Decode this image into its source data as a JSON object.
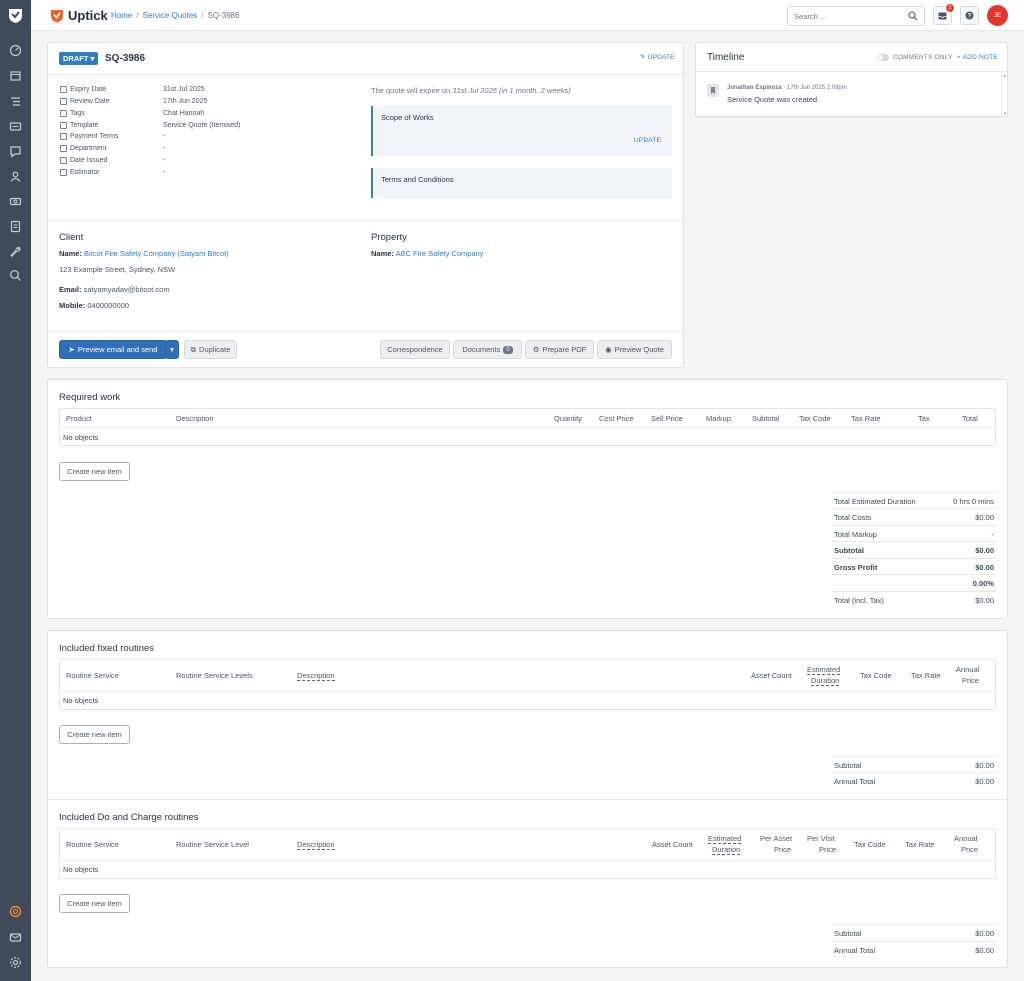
{
  "app": {
    "brand": "Uptick",
    "accent": "#2f7dc2",
    "brand_color": "#f26522"
  },
  "sidebar": {
    "icons": [
      "dashboard-icon",
      "calendar-icon",
      "tasks-icon",
      "card-icon",
      "chat-icon",
      "user-icon",
      "money-icon",
      "document-icon",
      "wrench-icon",
      "search-globe-icon"
    ],
    "bottom_icons": [
      "support-icon",
      "mail-icon",
      "settings-icon"
    ]
  },
  "header": {
    "breadcrumb": [
      "Home",
      "Service Quotes",
      "SQ-3986"
    ],
    "search_placeholder": "Search ...",
    "notification_count": "1",
    "avatar_initials": "JE"
  },
  "quote": {
    "status": "DRAFT",
    "id": "SQ-3986",
    "update_label": "UPDATE",
    "details": [
      {
        "label": "Expiry Date",
        "value": "31st Jul 2025",
        "link": false
      },
      {
        "label": "Review Date",
        "value": "17th Jun 2025",
        "link": false
      },
      {
        "label": "Tags",
        "value": "Chat Hannah",
        "link": true
      },
      {
        "label": "Template",
        "value": "Service Quote (Itemised)",
        "link": false
      },
      {
        "label": "Payment Terms",
        "value": "-",
        "link": false
      },
      {
        "label": "Department",
        "value": "-",
        "link": false
      },
      {
        "label": "Date Issued",
        "value": "-",
        "link": false
      },
      {
        "label": "Estimator",
        "value": "-",
        "link": false
      }
    ],
    "expire_prefix": "The quote will expire on ",
    "expire_value": "31st Jul 2025 (in 1 month, 2 weeks)",
    "scope_title": "Scope of Works",
    "scope_update": "UPDATE",
    "terms_title": "Terms and Conditions",
    "client": {
      "title": "Client",
      "name_label": "Name:",
      "name": "Bitcot Fire Safety Company (Satyam Bitcot)",
      "address": "123 Example Street, Sydney, NSW",
      "email_label": "Email:",
      "email": "satyamyadav@bitcot.com",
      "mobile_label": "Mobile:",
      "mobile": "0400000000"
    },
    "property": {
      "title": "Property",
      "name_label": "Name:",
      "name": "ABC Fire Safety Company"
    },
    "actions": {
      "preview_send": "Preview email and send",
      "duplicate": "Duplicate",
      "correspondence": "Correspondence",
      "documents": "Documents",
      "documents_count": "0",
      "prepare_pdf": "Prepare PDF",
      "preview_quote": "Preview Quote"
    }
  },
  "timeline": {
    "title": "Timeline",
    "comments_only": "COMMENTS ONLY",
    "add_note": "+ ADD NOTE",
    "entries": [
      {
        "author": "Jonathan Espinoza",
        "time": "17th Jun 2025 2:09pm",
        "text": "Service Quote was created."
      }
    ]
  },
  "required_work": {
    "title": "Required work",
    "columns": [
      "Product",
      "Description",
      "Quantity",
      "Cost Price",
      "Sell Price",
      "Markup",
      "Subtotal",
      "Tax Code",
      "Tax Rate",
      "Tax",
      "Total"
    ],
    "empty": "No objects",
    "create_label": "Create new item",
    "summary": [
      {
        "label": "Total Estimated Duration",
        "value": "0 hrs 0 mins",
        "bold": false
      },
      {
        "label": "Total Costs",
        "value": "$0.00",
        "bold": false
      },
      {
        "label": "Total Markup",
        "value": "-",
        "bold": false
      },
      {
        "label": "Subtotal",
        "value": "$0.00",
        "bold": true
      },
      {
        "label": "Gross Profit",
        "value": "$0.00",
        "bold": true
      },
      {
        "label": "",
        "value": "0.00%",
        "bold": true
      },
      {
        "label": "Total (incl. Tax)",
        "value": "$0.00",
        "bold": false
      }
    ]
  },
  "fixed_routines": {
    "title": "Included fixed routines",
    "columns": [
      "Routine Service",
      "Routine Service Levels",
      "Description",
      "Asset Count",
      "Estimated",
      "Duration",
      "Tax Code",
      "Tax Rate",
      "Annual",
      "Price"
    ],
    "empty": "No objects",
    "create_label": "Create new item",
    "summary": [
      {
        "label": "Subtotal",
        "value": "$0.00"
      },
      {
        "label": "Annual Total",
        "value": "$0.00"
      }
    ]
  },
  "charge_routines": {
    "title": "Included Do and Charge routines",
    "columns": [
      "Routine Service",
      "Routine Service Level",
      "Description",
      "Asset Count",
      "Estimated",
      "Duration",
      "Per Asset",
      "Price",
      "Per Visit",
      "Price",
      "Tax Code",
      "Tax Rate",
      "Annual",
      "Price"
    ],
    "empty": "No objects",
    "create_label": "Create new item",
    "summary": [
      {
        "label": "Subtotal",
        "value": "$0.00"
      },
      {
        "label": "Annual Total",
        "value": "$0.00"
      }
    ]
  }
}
